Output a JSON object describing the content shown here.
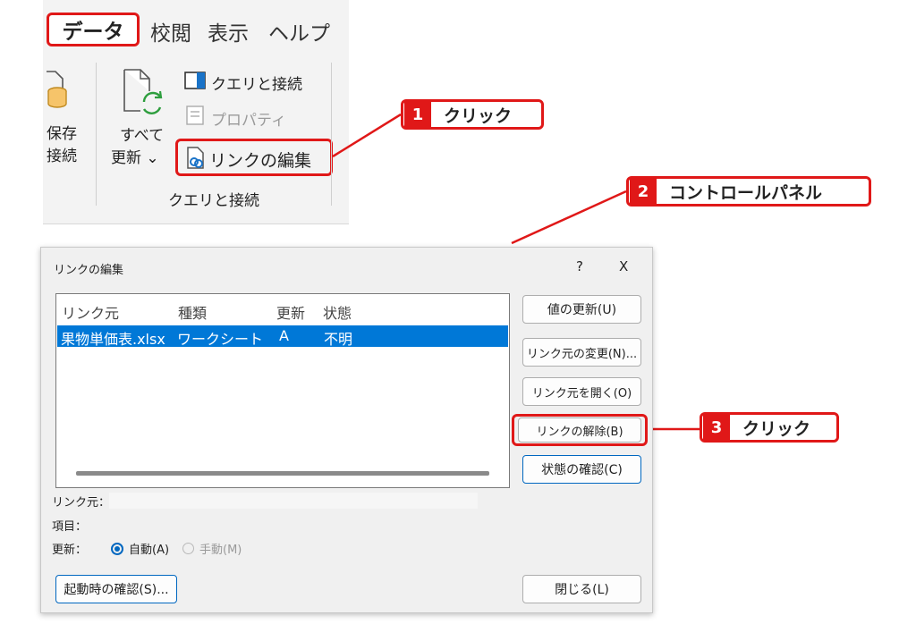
{
  "ribbon": {
    "tabs": [
      "データ",
      "校閲",
      "表示",
      "ヘルプ"
    ],
    "left_group": {
      "line1": "保存",
      "line2": "接続"
    },
    "refresh_all": {
      "line1": "すべて",
      "line2": "更新 ⌄"
    },
    "query_connections": "クエリと接続",
    "properties": "プロパティ",
    "edit_links": "リンクの編集",
    "group_label": "クエリと接続"
  },
  "callouts": [
    {
      "num": "1",
      "text": "クリック"
    },
    {
      "num": "2",
      "text": "コントロールパネル"
    },
    {
      "num": "3",
      "text": "クリック"
    }
  ],
  "dialog": {
    "title": "リンクの編集",
    "help": "?",
    "close": "X",
    "columns": [
      "リンク元",
      "種類",
      "更新",
      "状態"
    ],
    "rows": [
      {
        "source": "果物単価表.xlsx",
        "type": "ワークシート",
        "update": "A",
        "status": "不明"
      }
    ],
    "buttons": {
      "update_values": "値の更新(U)",
      "change_source": "リンク元の変更(N)...",
      "open_source": "リンク元を開く(O)",
      "break_link": "リンクの解除(B)",
      "check_status": "状態の確認(C)",
      "startup_prompt": "起動時の確認(S)...",
      "close": "閉じる(L)"
    },
    "labels": {
      "source": "リンク元：",
      "item": "項目：",
      "update": "更新："
    },
    "update_options": {
      "auto": "自動(A)",
      "manual": "手動(M)",
      "selected": "auto"
    }
  },
  "colors": {
    "accent_red": "#e01818",
    "selection_blue": "#0078d7",
    "radio_blue": "#0067c0"
  }
}
